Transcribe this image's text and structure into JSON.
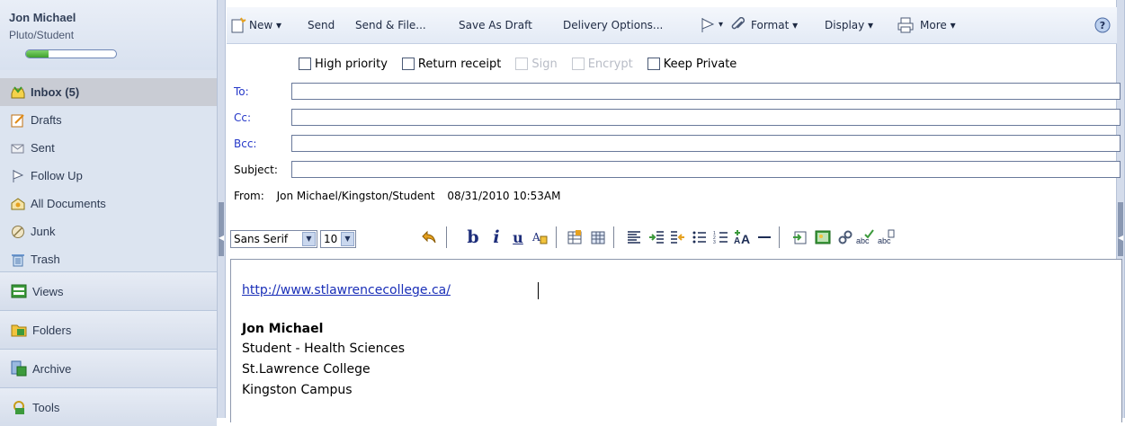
{
  "user": {
    "name": "Jon Michael",
    "org": "Pluto/Student",
    "quota_fraction": 0.25
  },
  "nav": [
    {
      "label": "Inbox (5)",
      "icon": "inbox-icon",
      "active": true
    },
    {
      "label": "Drafts",
      "icon": "drafts-icon"
    },
    {
      "label": "Sent",
      "icon": "sent-icon"
    },
    {
      "label": "Follow Up",
      "icon": "flag-icon"
    },
    {
      "label": "All Documents",
      "icon": "documents-icon"
    },
    {
      "label": "Junk",
      "icon": "junk-icon"
    },
    {
      "label": "Trash",
      "icon": "trash-icon"
    }
  ],
  "sections": [
    {
      "label": "Views",
      "icon": "views-icon"
    },
    {
      "label": "Folders",
      "icon": "folders-icon"
    },
    {
      "label": "Archive",
      "icon": "archive-icon"
    },
    {
      "label": "Tools",
      "icon": "tools-icon"
    }
  ],
  "toolbar": {
    "new": "New ▾",
    "send": "Send",
    "send_file": "Send & File...",
    "save_draft": "Save As Draft",
    "delivery": "Delivery Options...",
    "format": "Format ▾",
    "display": "Display ▾",
    "more": "More ▾"
  },
  "options": {
    "high_priority": "High priority",
    "return_receipt": "Return receipt",
    "sign": "Sign",
    "encrypt": "Encrypt",
    "keep_private": "Keep Private"
  },
  "fields": {
    "to": "To:",
    "cc": "Cc:",
    "bcc": "Bcc:",
    "subject": "Subject:"
  },
  "from": {
    "label": "From:",
    "name": "Jon Michael/Kingston/Student",
    "datetime": "08/31/2010 10:53AM"
  },
  "editor": {
    "font": "Sans Serif",
    "size": "10"
  },
  "body": {
    "link": "http://www.stlawrencecollege.ca/",
    "sig_name": "Jon Michael",
    "sig_line1": "Student - Health Sciences",
    "sig_line2": "St.Lawrence College",
    "sig_line3": "Kingston Campus"
  },
  "colors": {
    "accent": "#2437c8",
    "sidebar_bg": "#dce4f0",
    "active_row": "#c9ccd4"
  }
}
